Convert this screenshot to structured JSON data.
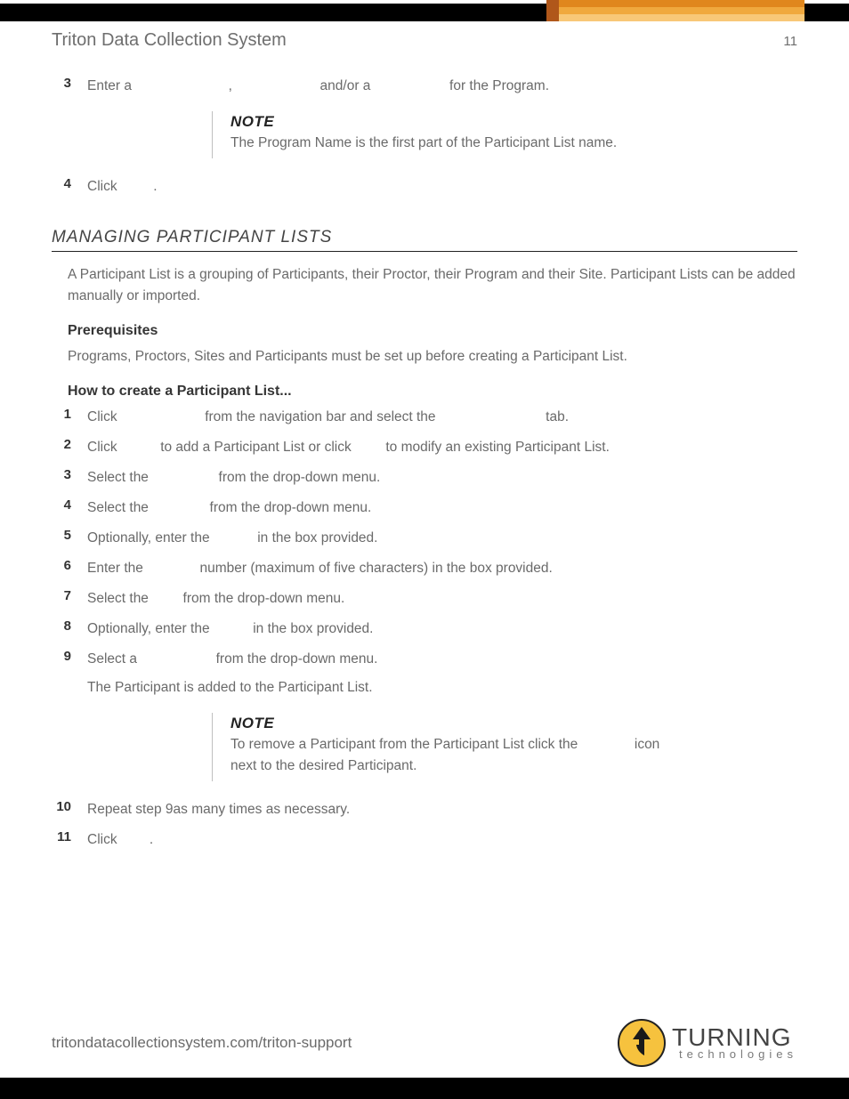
{
  "header": {
    "title": "Triton Data Collection System",
    "page_number": "11"
  },
  "continued_steps": {
    "step3": {
      "num": "3",
      "text_a": "Enter a ",
      "text_b": ", ",
      "text_c": " and/or a ",
      "text_d": " for the Program."
    },
    "note1": {
      "label": "NOTE",
      "text": "The Program Name is the first part of the Participant List name."
    },
    "step4": {
      "num": "4",
      "text_a": "Click ",
      "text_b": "."
    }
  },
  "section": {
    "heading": "MANAGING PARTICIPANT LISTS",
    "intro": "A Participant List is a grouping of Participants, their Proctor, their Program and their Site. Participant Lists can be added manually or imported.",
    "prereq_heading": "Prerequisites",
    "prereq_text": "Programs, Proctors, Sites and Participants must be set up before creating a Participant List.",
    "howto_heading": "How to create a Participant List...",
    "steps": {
      "s1": {
        "num": "1",
        "a": "Click ",
        "b": " from the navigation bar and select the ",
        "c": " tab."
      },
      "s2": {
        "num": "2",
        "a": "Click ",
        "b": " to add a Participant List or click ",
        "c": " to modify an existing Participant List."
      },
      "s3": {
        "num": "3",
        "a": "Select the ",
        "b": " from the drop-down menu."
      },
      "s4": {
        "num": "4",
        "a": "Select the ",
        "b": " from the drop-down menu."
      },
      "s5": {
        "num": "5",
        "a": "Optionally, enter the ",
        "b": " in the box provided."
      },
      "s6": {
        "num": "6",
        "a": "Enter the ",
        "b": " number (maximum of five characters) in the box provided."
      },
      "s7": {
        "num": "7",
        "a": "Select the ",
        "b": " from the drop-down menu."
      },
      "s8": {
        "num": "8",
        "a": "Optionally, enter the ",
        "b": " in the box provided."
      },
      "s9": {
        "num": "9",
        "a": "Select a ",
        "b": " from the drop-down menu.",
        "after": "The Participant is added to the Participant List."
      },
      "s10": {
        "num": "10",
        "a": "Repeat step 9as many times as necessary."
      },
      "s11": {
        "num": "11",
        "a": "Click ",
        "b": "."
      }
    },
    "note2": {
      "label": "NOTE",
      "text_a": "To remove a Participant from the Participant List click the ",
      "text_b": " icon next to the desired Participant."
    }
  },
  "footer": {
    "url": "tritondatacollectionsystem.com/triton-support",
    "logo_top": "TURNING",
    "logo_bottom": "technologies"
  }
}
